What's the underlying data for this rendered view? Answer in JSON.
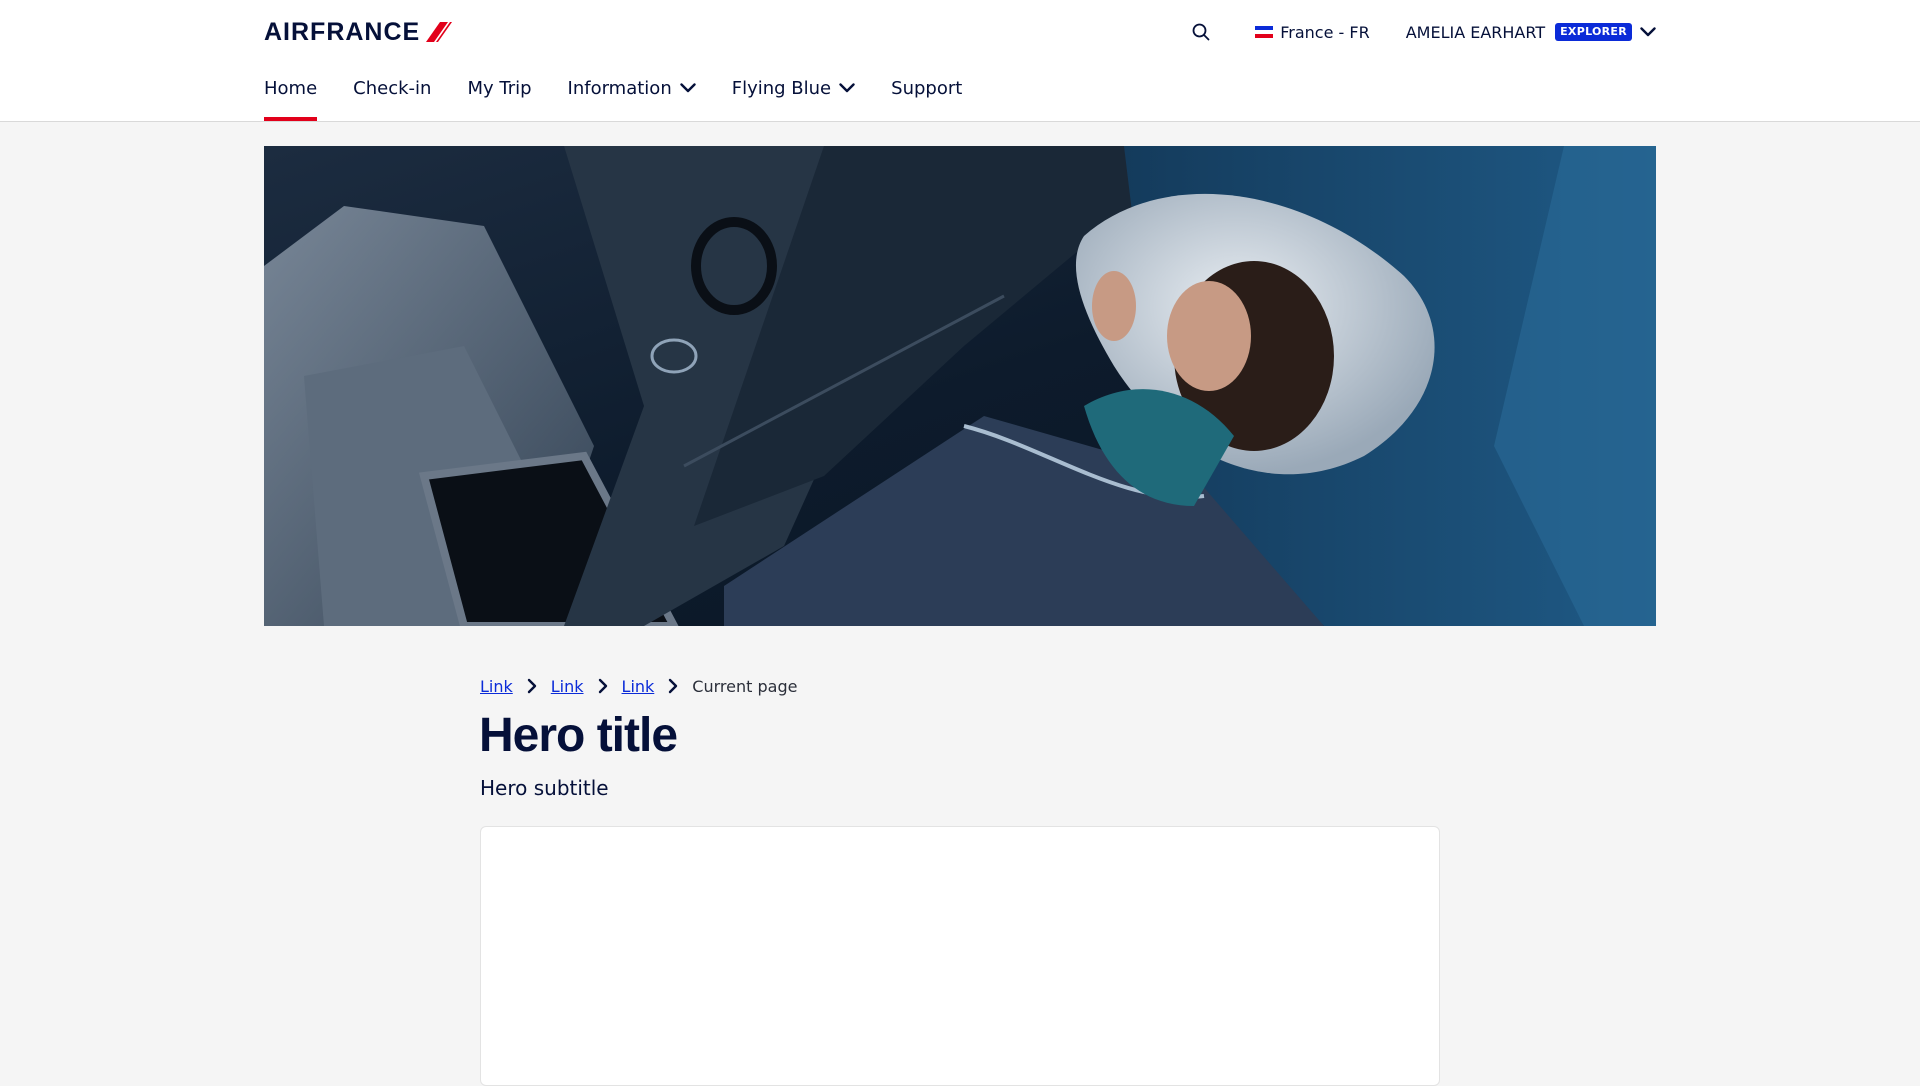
{
  "brand": {
    "logo_text": "AIRFRANCE",
    "primary_color": "#051039",
    "accent_red": "#e2001a",
    "link_blue": "#0b2bd8"
  },
  "header": {
    "search_icon": "search-icon",
    "locale": {
      "label": "France - FR",
      "flag_colors": [
        "#0b2bd8",
        "#ffffff",
        "#e2001a"
      ]
    },
    "user": {
      "name": "AMELIA EARHART",
      "tier_badge": "EXPLORER",
      "badge_color": "#0b2bd8"
    }
  },
  "nav": {
    "items": [
      {
        "label": "Home",
        "active": true
      },
      {
        "label": "Check-in"
      },
      {
        "label": "My Trip"
      },
      {
        "label": "Information",
        "has_dropdown": true
      },
      {
        "label": "Flying Blue",
        "has_dropdown": true
      },
      {
        "label": "Support"
      }
    ]
  },
  "breadcrumb": {
    "links": [
      "Link",
      "Link",
      "Link"
    ],
    "current": "Current page"
  },
  "hero": {
    "title": "Hero title",
    "subtitle": "Hero subtitle"
  }
}
